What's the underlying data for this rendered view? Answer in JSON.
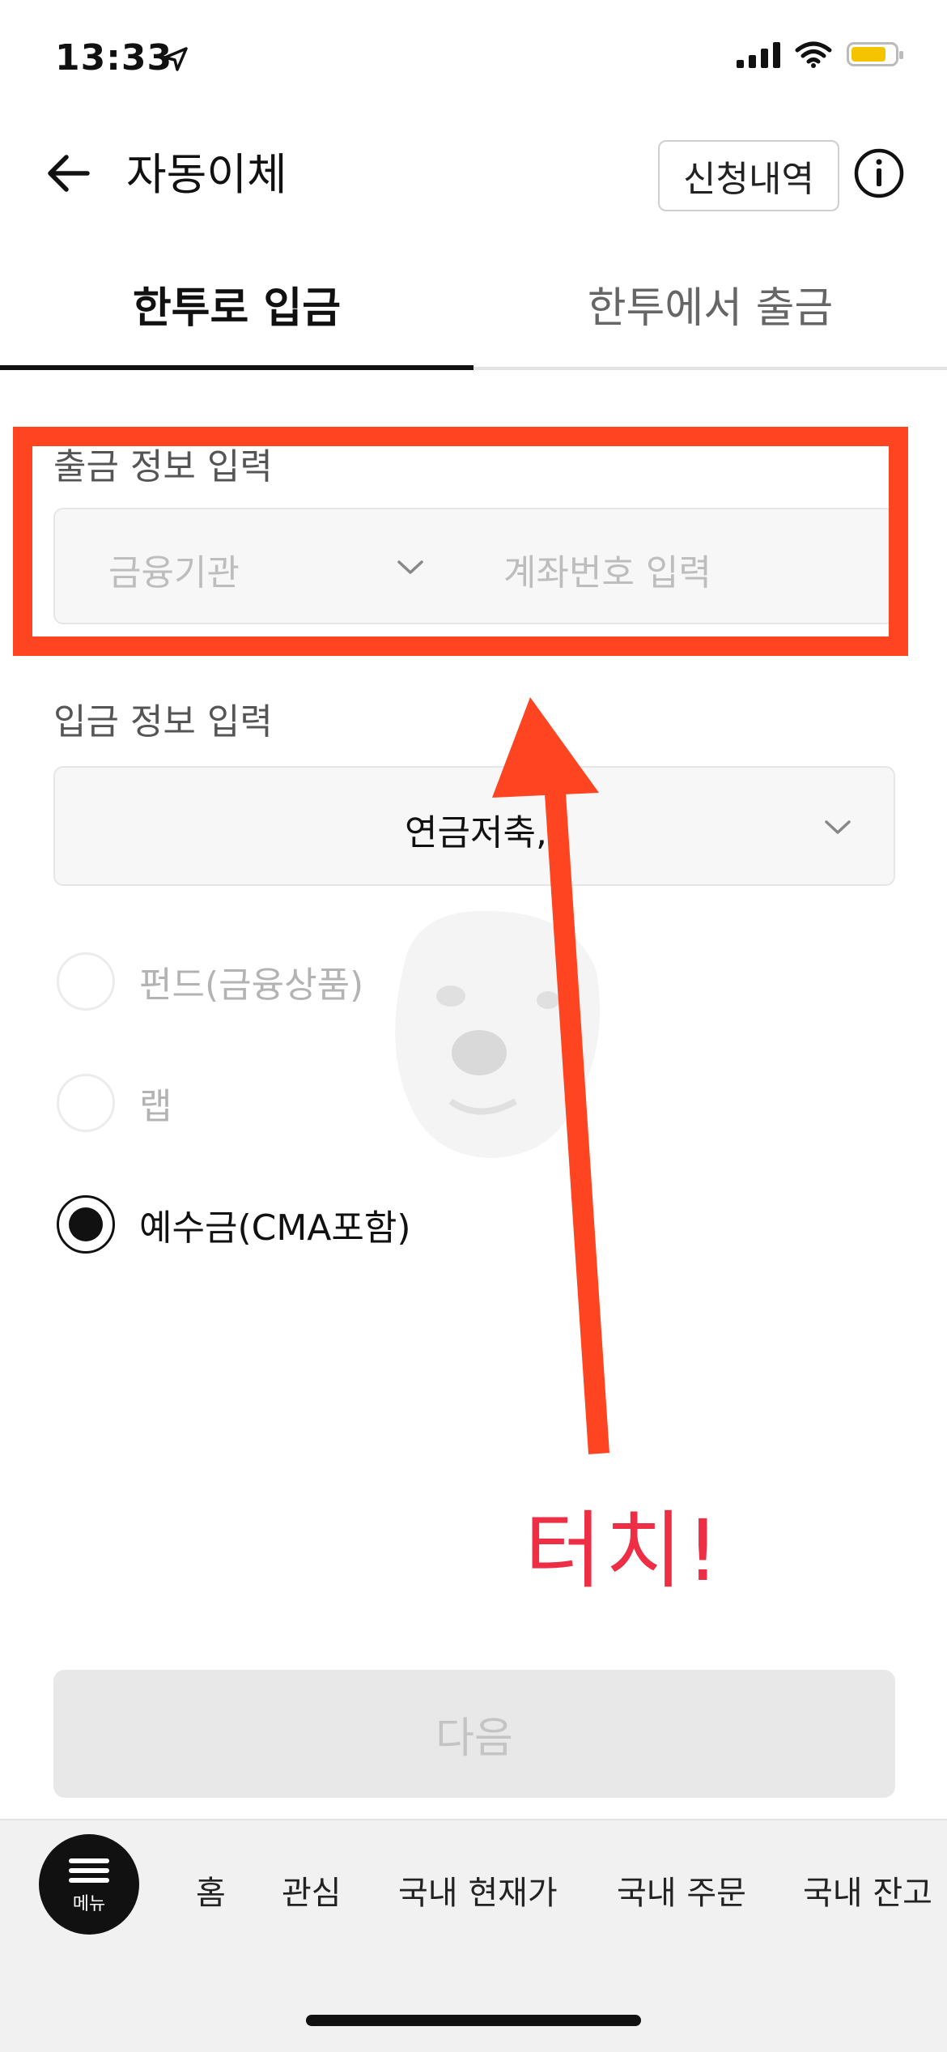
{
  "status_bar": {
    "time": "13:33"
  },
  "header": {
    "title": "자동이체",
    "history_button": "신청내역"
  },
  "tabs": [
    {
      "label": "한투로 입금",
      "active": true
    },
    {
      "label": "한투에서 출금",
      "active": false
    }
  ],
  "withdrawal": {
    "label": "출금 정보 입력",
    "institution_placeholder": "금융기관",
    "account_placeholder": "계좌번호 입력"
  },
  "deposit": {
    "label": "입금 정보 입력",
    "account_value": "연금저축,"
  },
  "radio_options": [
    {
      "label": "펀드(금융상품)",
      "checked": false,
      "enabled": false
    },
    {
      "label": "랩",
      "checked": false,
      "enabled": false
    },
    {
      "label": "예수금(CMA포함)",
      "checked": true,
      "enabled": true
    }
  ],
  "annotation": {
    "touch_text": "터치!",
    "color": "#ee2e44",
    "highlight_color": "#ff4422"
  },
  "next_button": {
    "label": "다음"
  },
  "bottom_nav": {
    "menu_label": "메뉴",
    "items": [
      "홈",
      "관심",
      "국내 현재가",
      "국내 주문",
      "국내 잔고"
    ]
  }
}
